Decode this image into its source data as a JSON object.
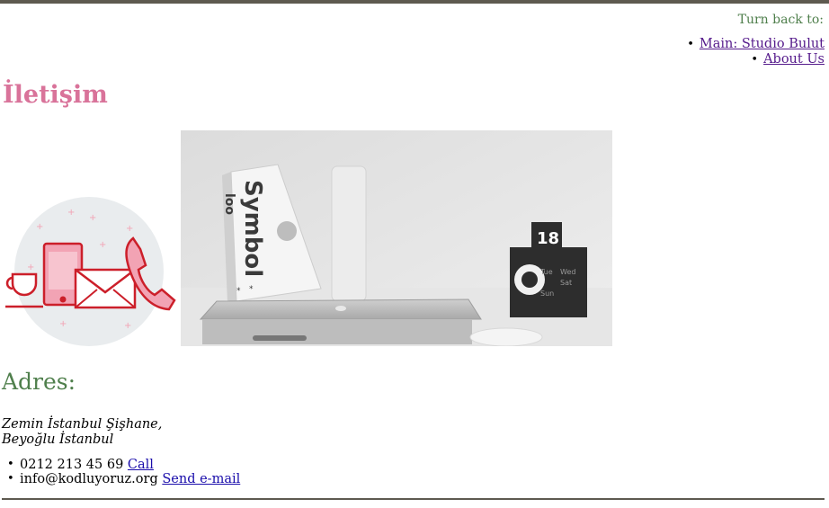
{
  "header": {
    "turn_back_label": "Turn back to:",
    "nav": [
      {
        "label": "Main: Studio Bulut"
      },
      {
        "label": "About Us"
      }
    ]
  },
  "page": {
    "title": "İletişim"
  },
  "images": {
    "illustration": {
      "icon": "contact-icons-phone-mail-cup"
    },
    "photo": {
      "icon": "desk-photo",
      "book_title": "Symbol",
      "calendar_date": "18",
      "calendar_days": [
        "Tue",
        "Wed",
        "Sat",
        "Sun"
      ]
    }
  },
  "address_section": {
    "title": "Adres:",
    "line1": "Zemin İstanbul Şişhane,",
    "line2": "Beyoğlu İstanbul"
  },
  "contacts": [
    {
      "value": "0212 213 45 69",
      "link_label": "Call"
    },
    {
      "value": "info@kodluyoruz.org",
      "link_label": "Send e-mail"
    }
  ],
  "colors": {
    "accent_pink": "#d9739a",
    "accent_green": "#4f7f4c",
    "icon_red": "#cc1f2a"
  }
}
